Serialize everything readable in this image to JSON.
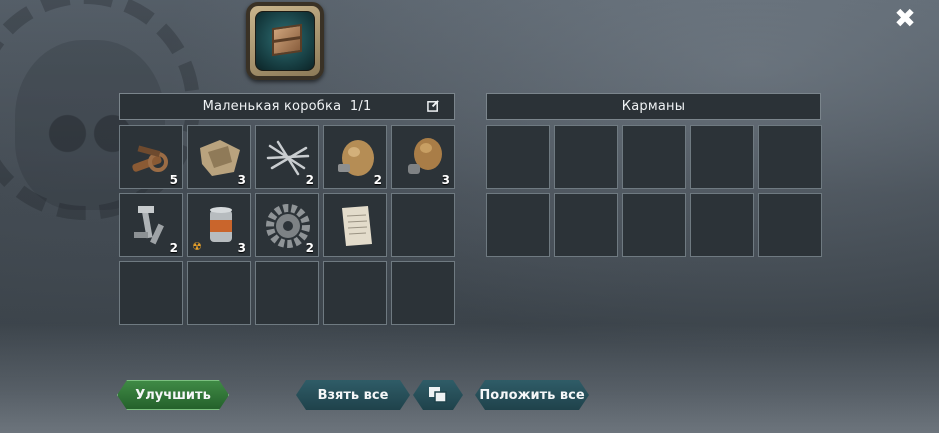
{
  "header": {
    "container_icon": "wooden-crate-icon",
    "close_icon": "close-icon",
    "close_glyph": "✖"
  },
  "container_panel": {
    "title": "Маленькая коробка  1/1",
    "edit_icon": "edit-icon",
    "slots": [
      {
        "item": "scrap-metal",
        "qty": "5"
      },
      {
        "item": "rags",
        "qty": "3"
      },
      {
        "item": "nails",
        "qty": "2"
      },
      {
        "item": "canteen",
        "qty": "2"
      },
      {
        "item": "flask",
        "qty": "3"
      },
      {
        "item": "bolts",
        "qty": "2"
      },
      {
        "item": "canned-food",
        "qty": "3",
        "radioactive": true
      },
      {
        "item": "gear",
        "qty": "2"
      },
      {
        "item": "paper",
        "qty": ""
      },
      {
        "item": "",
        "qty": ""
      },
      {
        "item": "",
        "qty": ""
      },
      {
        "item": "",
        "qty": ""
      },
      {
        "item": "",
        "qty": ""
      },
      {
        "item": "",
        "qty": ""
      },
      {
        "item": "",
        "qty": ""
      }
    ]
  },
  "pockets_panel": {
    "title": "Карманы",
    "slot_count": 10
  },
  "buttons": {
    "upgrade": "Улучшить",
    "take_all": "Взять все",
    "swap_icon": "stack-swap-icon",
    "put_all": "Положить все"
  },
  "colors": {
    "upgrade_button": "#3f8a45",
    "action_button": "#2f5c67",
    "slot_bg": "#2c3338"
  }
}
